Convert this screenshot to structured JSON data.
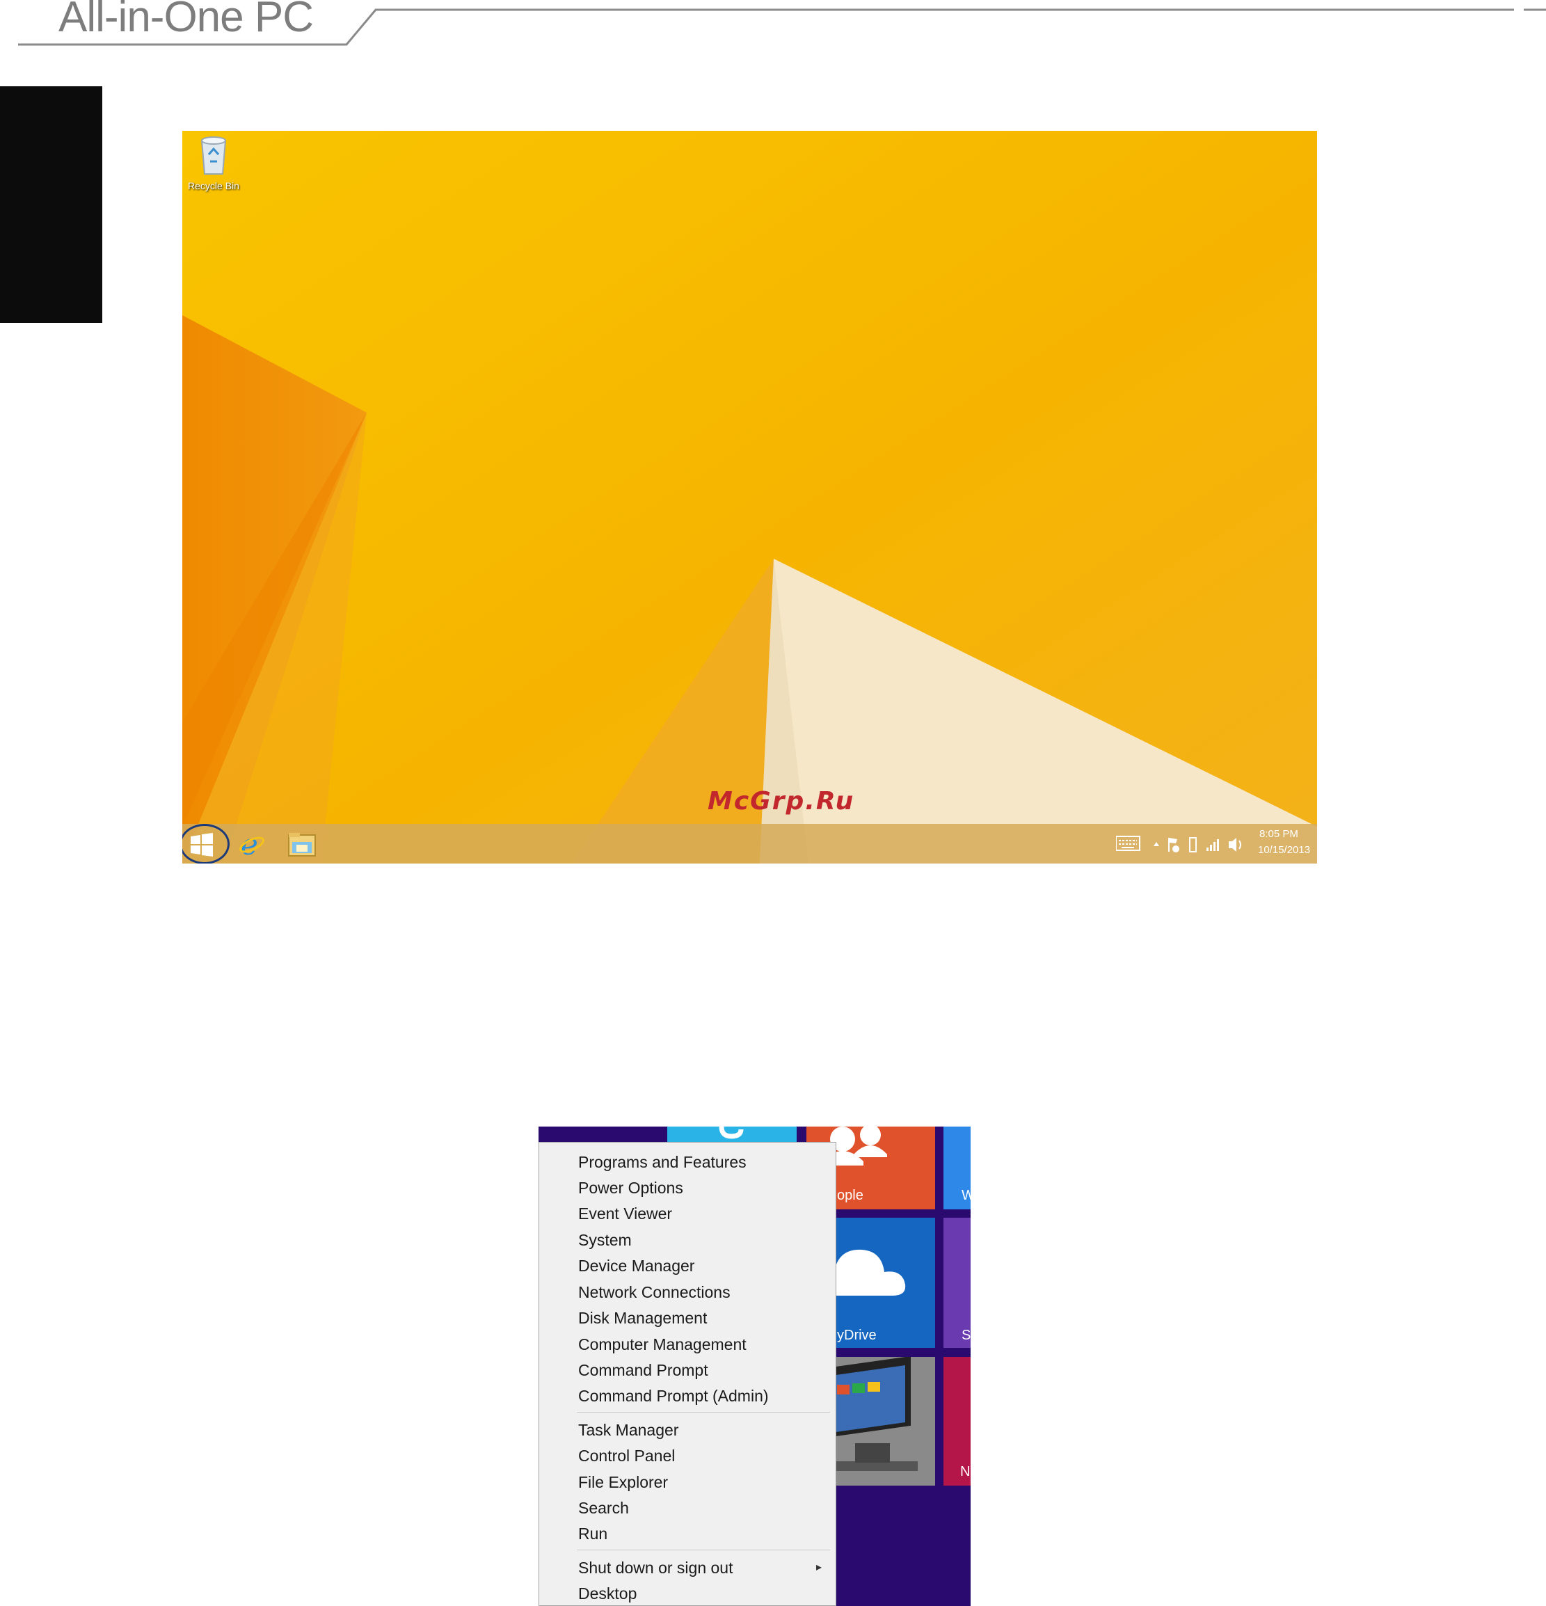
{
  "header": {
    "title": "All-in-One PC"
  },
  "desktop": {
    "recycle_bin_label": "Recycle Bin",
    "watermark": "McGrp.Ru",
    "taskbar": {
      "icons": [
        "windows-logo-icon",
        "internet-explorer-icon",
        "file-explorer-icon"
      ],
      "tray_icons": [
        "keyboard-icon",
        "show-hidden-icon",
        "action-center-flag-icon",
        "battery-icon",
        "signal-icon",
        "volume-icon"
      ],
      "clock_time": "8:05 PM",
      "clock_date": "10/15/2013"
    },
    "colors": {
      "wallpaper": "#f7b600",
      "start_highlight_ring": "#1c3a7a"
    }
  },
  "context_menu": {
    "group1": [
      "Programs and Features",
      "Power Options",
      "Event Viewer",
      "System",
      "Device Manager",
      "Network Connections",
      "Disk Management",
      "Computer Management",
      "Command Prompt",
      "Command Prompt (Admin)"
    ],
    "group2": [
      "Task Manager",
      "Control Panel",
      "File Explorer",
      "Search",
      "Run"
    ],
    "group3": [
      "Shut down or sign out",
      "Desktop"
    ],
    "submenu_arrow": "▸"
  },
  "start_tiles": {
    "people_partial": "ople",
    "onedrive_partial": "yDrive",
    "tile_w": "W",
    "tile_s": "S",
    "tile_n": "N",
    "colors": {
      "background": "#2a0a6e",
      "people": "#e0522b",
      "onedrive": "#1566c0",
      "weather": "#2e88e8",
      "purple": "#6a3ab0",
      "news": "#b4164a",
      "skype": "#29b3e6"
    }
  }
}
